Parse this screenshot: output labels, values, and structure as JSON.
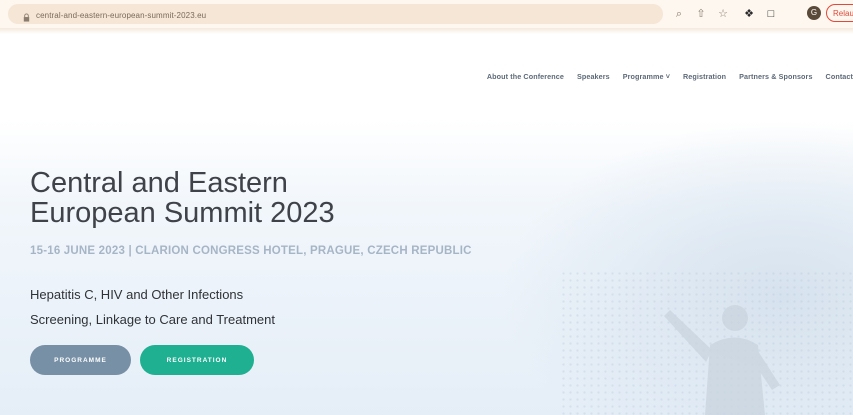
{
  "browser": {
    "url": "central-and-eastern-european-summit-2023.eu",
    "icons": [
      "search-icon",
      "share-icon",
      "star-icon",
      "extension-icon",
      "sidebar-icon",
      "profile-avatar"
    ],
    "profile_initial": "G",
    "update_label": "Relau"
  },
  "nav": {
    "items": [
      "About the Conference",
      "Speakers",
      "Programme ˅",
      "Registration",
      "Partners & Sponsors",
      "Contact"
    ]
  },
  "hero": {
    "title_line1": "Central and Eastern",
    "title_line2": "European Summit 2023",
    "date_line": "15-16 JUNE 2023 | CLARION CONGRESS HOTEL, PRAGUE, CZECH REPUBLIC",
    "subtitle_line1": "Hepatitis C, HIV and Other Infections",
    "subtitle_line2": "Screening, Linkage to Care and Treatment",
    "buttons": {
      "programme": "PROGRAMME",
      "registration": "REGISTRATION"
    }
  },
  "colors": {
    "nav_text": "#5d6a78",
    "title": "#3f4349",
    "date": "#a6b5c6",
    "programme_button": "#7790a6",
    "registration_button": "#1fb092",
    "update_pill": "#e04a3a"
  }
}
